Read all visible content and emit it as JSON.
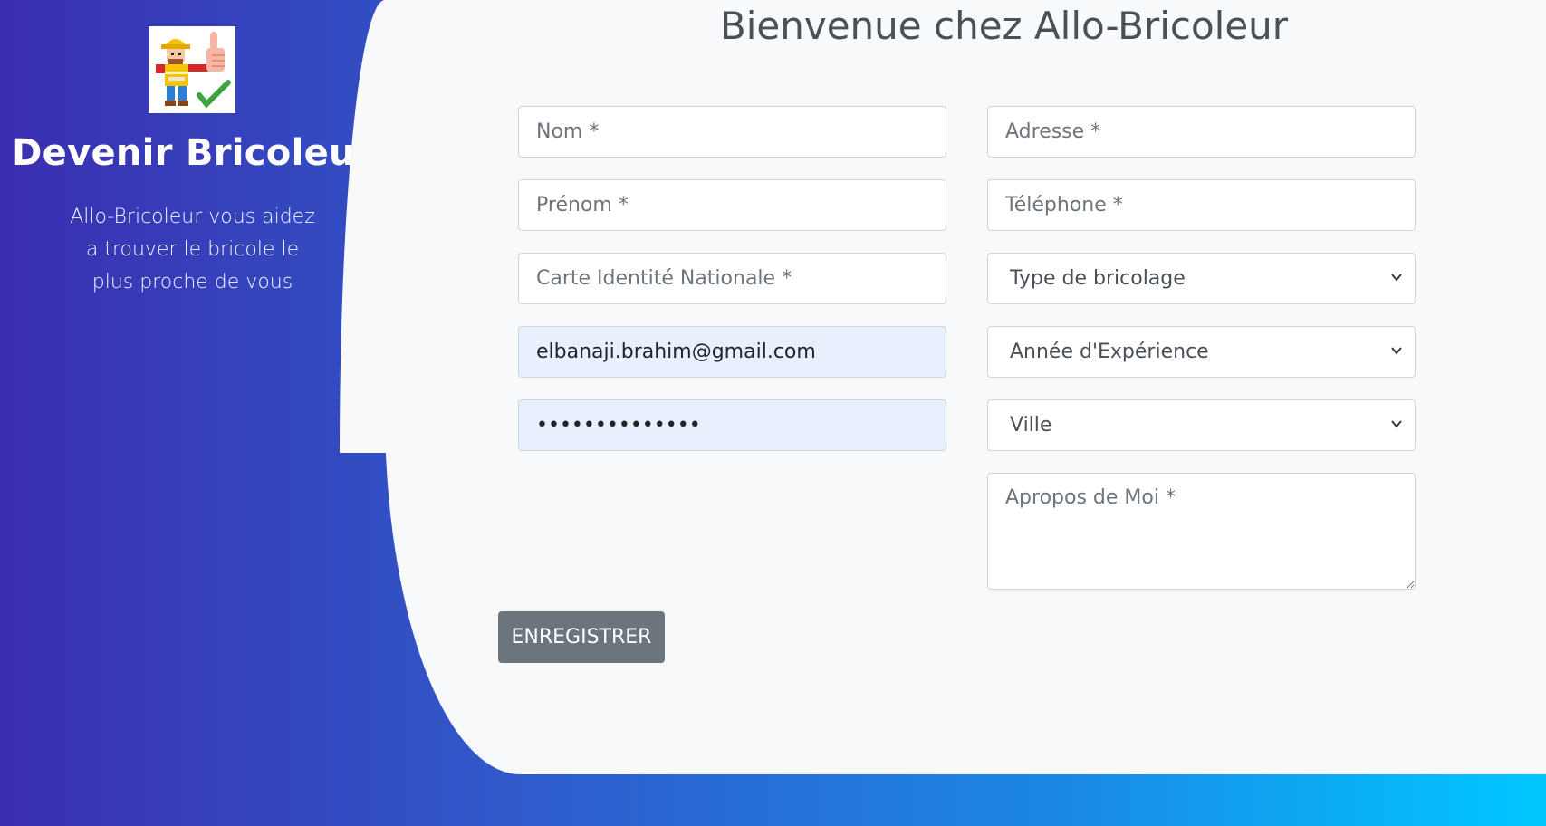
{
  "sidebar": {
    "title": "Devenir Bricoleur",
    "description": "Allo-Bricoleur vous aidez a trouver le bricole le plus proche de vous",
    "logo_icon": "handyman-thumbs-up-icon"
  },
  "main": {
    "title": "Bienvenue chez Allo-Bricoleur"
  },
  "form": {
    "nom": {
      "placeholder": "Nom *",
      "value": ""
    },
    "prenom": {
      "placeholder": "Prénom *",
      "value": ""
    },
    "cin": {
      "placeholder": "Carte Identité Nationale *",
      "value": ""
    },
    "email": {
      "placeholder": "",
      "value": "elbanaji.brahim@gmail.com"
    },
    "password": {
      "placeholder": "",
      "value": "••••••••••••••"
    },
    "adresse": {
      "placeholder": "Adresse *",
      "value": ""
    },
    "telephone": {
      "placeholder": "Téléphone *",
      "value": ""
    },
    "type_bricolage": {
      "selected": "Type de bricolage"
    },
    "experience": {
      "selected": "Année d'Expérience"
    },
    "ville": {
      "selected": "Ville"
    },
    "apropos": {
      "placeholder": "Apropos de Moi *",
      "value": ""
    },
    "submit_label": "ENREGISTRER"
  },
  "colors": {
    "gradient_start": "#3a2eb0",
    "gradient_end": "#00c8ff",
    "panel_bg": "#f8f9fa",
    "button_bg": "#6c757d",
    "autofill_bg": "#e8f0fe"
  }
}
